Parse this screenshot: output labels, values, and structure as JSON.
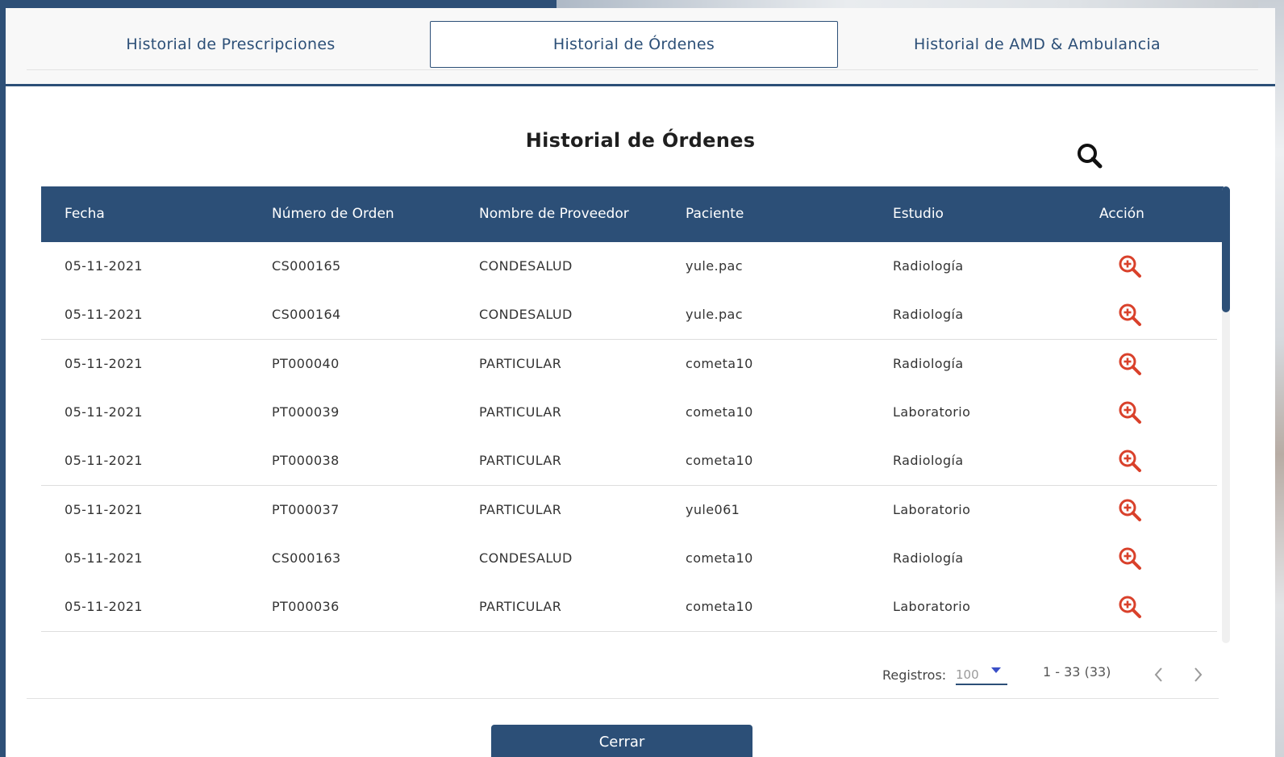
{
  "tabs": [
    {
      "label": "Historial de Prescripciones"
    },
    {
      "label": "Historial de Órdenes"
    },
    {
      "label": "Historial de AMD & Ambulancia"
    }
  ],
  "page_title": "Historial de Órdenes",
  "icons": {
    "search": "search-icon",
    "action": "zoom-in-icon",
    "prev": "chevron-left-icon",
    "next": "chevron-right-icon"
  },
  "colors": {
    "primary": "#2c4f77",
    "action": "#d9412b"
  },
  "table": {
    "columns": [
      "Fecha",
      "Número de Orden",
      "Nombre de Proveedor",
      "Paciente",
      "Estudio",
      "Acción"
    ],
    "rows": [
      [
        "05-11-2021",
        "CS000165",
        "CONDESALUD",
        "yule.pac",
        "Radiología"
      ],
      [
        "05-11-2021",
        "CS000164",
        "CONDESALUD",
        "yule.pac",
        "Radiología"
      ],
      [
        "05-11-2021",
        "PT000040",
        "PARTICULAR",
        "cometa10",
        "Radiología"
      ],
      [
        "05-11-2021",
        "PT000039",
        "PARTICULAR",
        "cometa10",
        "Laboratorio"
      ],
      [
        "05-11-2021",
        "PT000038",
        "PARTICULAR",
        "cometa10",
        "Radiología"
      ],
      [
        "05-11-2021",
        "PT000037",
        "PARTICULAR",
        "yule061",
        "Laboratorio"
      ],
      [
        "05-11-2021",
        "CS000163",
        "CONDESALUD",
        "cometa10",
        "Radiología"
      ],
      [
        "05-11-2021",
        "PT000036",
        "PARTICULAR",
        "cometa10",
        "Laboratorio"
      ]
    ]
  },
  "pagination": {
    "records_label": "Registros:",
    "page_size": "100",
    "range": "1 - 33 (33)"
  },
  "close_button": "Cerrar"
}
